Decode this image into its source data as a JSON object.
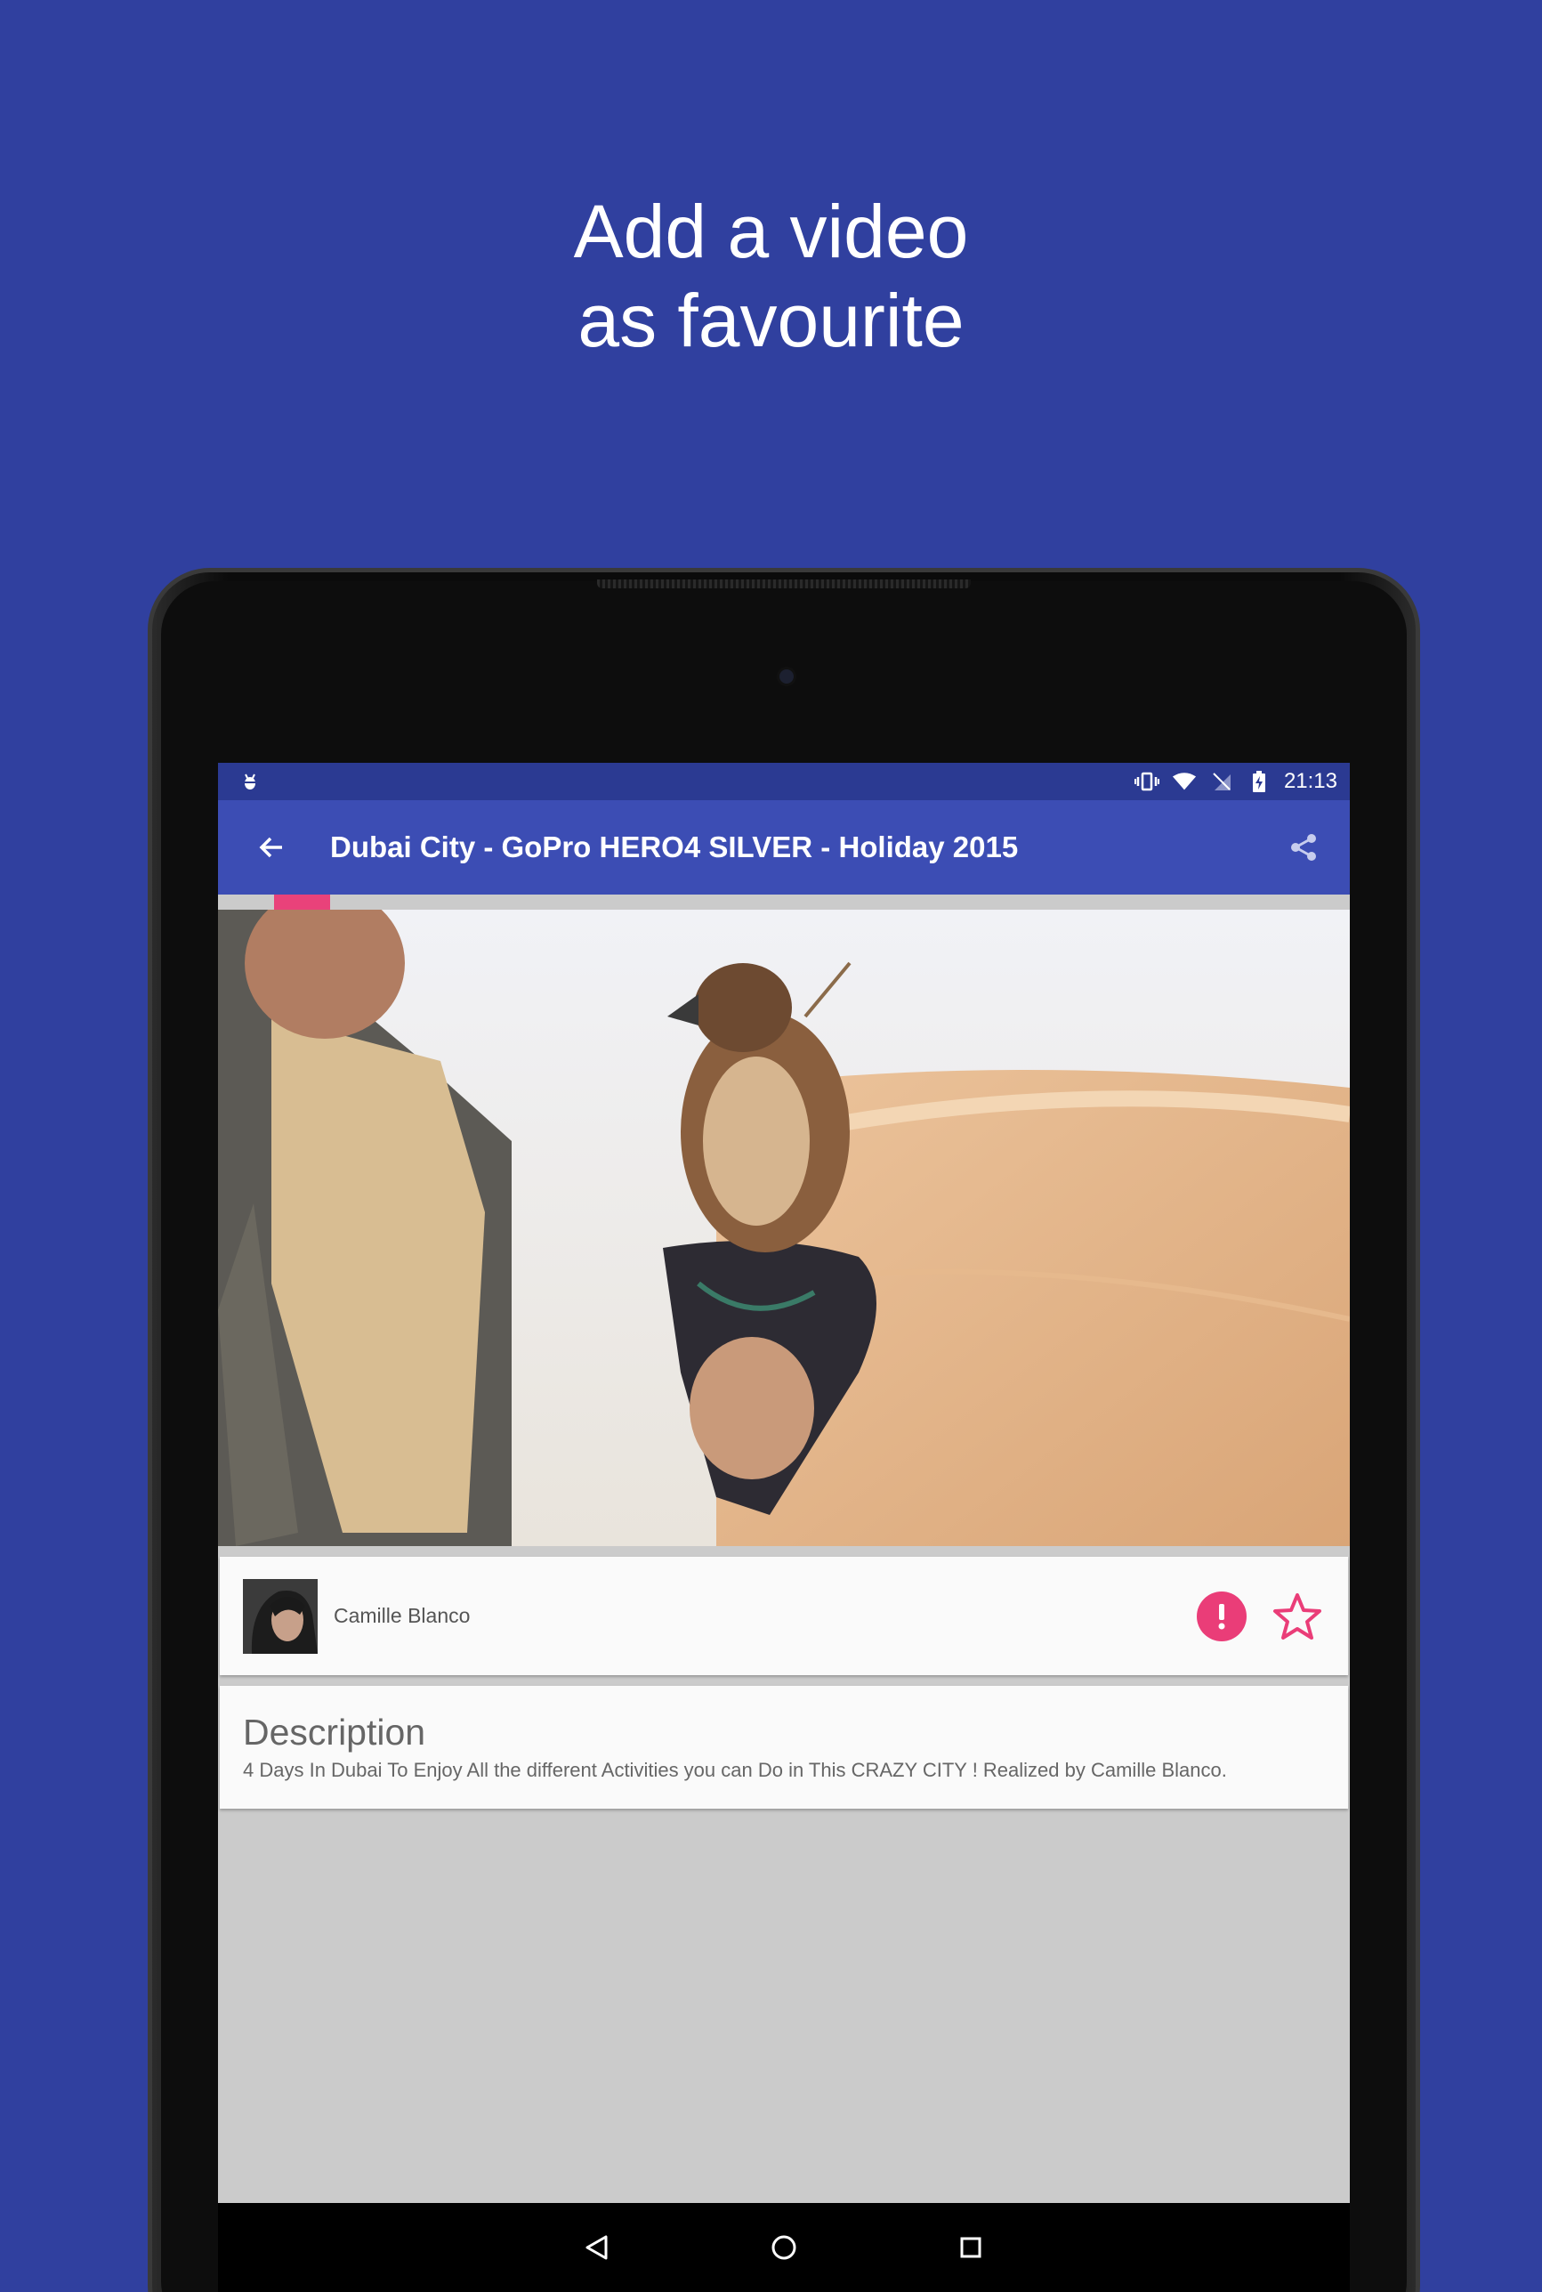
{
  "promo": {
    "line1": "Add a video",
    "line2": "as favourite"
  },
  "status_bar": {
    "time": "21:13",
    "icons": [
      "android-debug-icon",
      "vibrate-icon",
      "wifi-icon",
      "no-sim-icon",
      "battery-charging-icon"
    ]
  },
  "app_bar": {
    "title": "Dubai City - GoPro HERO4 SILVER - Holiday 2015",
    "back_icon": "arrow-back-icon",
    "share_icon": "share-icon"
  },
  "author": {
    "name": "Camille Blanco",
    "report_icon": "report-icon",
    "favourite_icon": "star-outline-icon"
  },
  "description": {
    "title": "Description",
    "text": "4 Days In Dubai To Enjoy All the different Activities you can Do in This CRAZY CITY ! Realized by Camille Blanco."
  },
  "nav_bar": {
    "icons": [
      "nav-back-icon",
      "nav-home-icon",
      "nav-recents-icon"
    ]
  },
  "colors": {
    "background": "#30409f",
    "app_bar": "#3c4db4",
    "status_bar": "#2b3a92",
    "accent": "#e9427a"
  }
}
